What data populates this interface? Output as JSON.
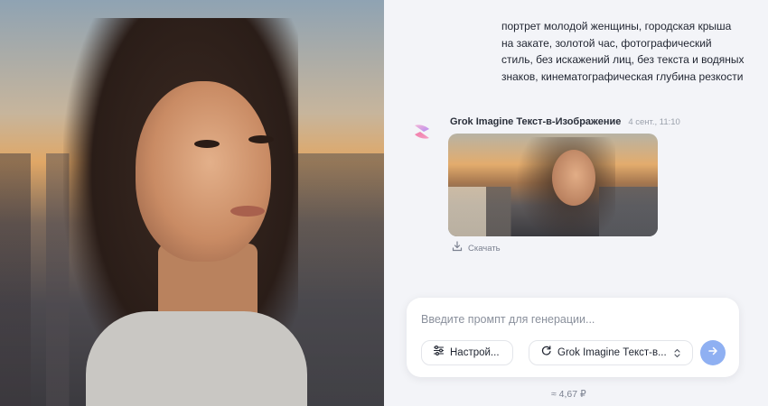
{
  "prompt_message": {
    "text": "портрет молодой женщины, городская крыша на закате, золотой час, фотографический стиль, без искажений лиц, без текста и водяных знаков, кинематографическая глубина резкости"
  },
  "bot_message": {
    "name": "Grok Imagine Текст-в-Изображение",
    "time": "4 сент., 11:10",
    "avatar_icon": "grok-logo-icon",
    "download_label": "Скачать",
    "download_icon": "download-icon"
  },
  "composer": {
    "placeholder": "Введите промпт для генерации...",
    "settings_label": "Настрой...",
    "settings_icon": "sliders-icon",
    "model_label": "Grok Imagine Текст-в...",
    "model_icon": "refresh-icon",
    "send_icon": "arrow-right-icon",
    "send_color": "#8fb0f2"
  },
  "cost": {
    "text": "≈ 4,67 ₽"
  }
}
